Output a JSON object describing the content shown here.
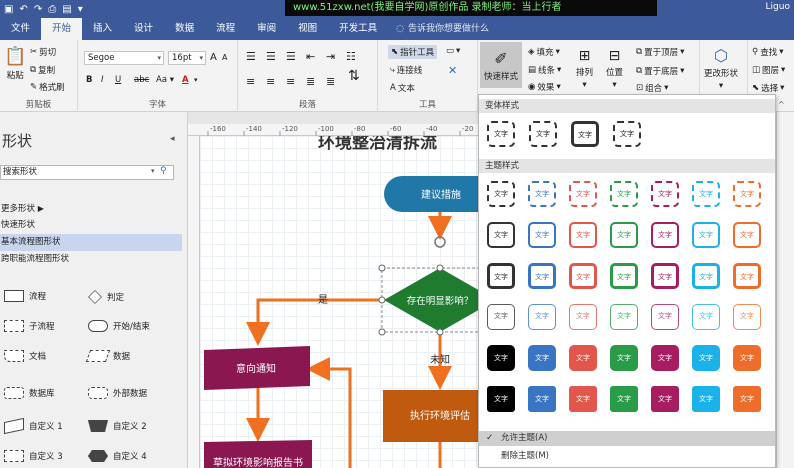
{
  "titlebar": {
    "banner": "www.51zxw.net(我要自学网)原创作品 录制老师：当上行者",
    "user": "Liguo"
  },
  "tabs": [
    {
      "label": "文件"
    },
    {
      "label": "开始"
    },
    {
      "label": "插入"
    },
    {
      "label": "设计"
    },
    {
      "label": "数据"
    },
    {
      "label": "流程"
    },
    {
      "label": "审阅"
    },
    {
      "label": "视图"
    },
    {
      "label": "开发工具"
    }
  ],
  "tellme": "告诉我你想要做什么",
  "ribbon": {
    "clipboard": {
      "label": "剪贴板",
      "paste": "粘贴",
      "cut": "剪切",
      "copy": "复制",
      "format_painter": "格式刷"
    },
    "font": {
      "label": "字体",
      "family": "Segoe",
      "size": "16pt"
    },
    "paragraph": {
      "label": "段落"
    },
    "tools": {
      "label": "工具",
      "pointer": "指针工具",
      "connector": "连接线",
      "text": "文本"
    },
    "shape_styles": {
      "quick": "快速样式",
      "fill": "填充",
      "line": "线条",
      "effects": "效果"
    },
    "arrange": {
      "arrange": "排列",
      "position": "位置",
      "front": "置于顶层",
      "back": "置于底层",
      "group": "组合"
    },
    "change_shape": "更改形状",
    "editing": {
      "find": "查找",
      "layer": "图层",
      "select": "选择"
    }
  },
  "shapes_pane": {
    "title": "形状",
    "search": "搜索形状",
    "stencils": [
      "更多形状",
      "快速形状",
      "基本流程图形状",
      "跨职能流程图形状"
    ],
    "shapes": [
      {
        "label": "流程",
        "icon": "process-icon"
      },
      {
        "label": "判定",
        "icon": "decision-icon"
      },
      {
        "label": "子流程",
        "icon": "subprocess-icon"
      },
      {
        "label": "开始/结束",
        "icon": "start-end-icon"
      },
      {
        "label": "文档",
        "icon": "document-icon"
      },
      {
        "label": "数据",
        "icon": "data-icon"
      },
      {
        "label": "数据库",
        "icon": "database-icon"
      },
      {
        "label": "外部数据",
        "icon": "external-data-icon"
      },
      {
        "label": "自定义 1",
        "icon": "custom1-icon"
      },
      {
        "label": "自定义 2",
        "icon": "custom2-icon"
      },
      {
        "label": "自定义 3",
        "icon": "custom3-icon"
      },
      {
        "label": "自定义 4",
        "icon": "custom4-icon"
      }
    ]
  },
  "ruler_labels": [
    "-160",
    "-140",
    "-120",
    "-100",
    "-80",
    "-60",
    "-40",
    "-20"
  ],
  "diagram": {
    "title": "环境整治清拆流",
    "nodes": {
      "n1": "建议措施",
      "n2": "存在明显影响？",
      "n3": "意向通知",
      "n4": "执行环境评估",
      "n5": "草拟环境影响报告书"
    },
    "labels": {
      "yes": "是",
      "no": "未知"
    },
    "colors": {
      "start": "#1f78a8",
      "decision": "#1f7b2e",
      "notice": "#8b1750",
      "process": "#c05a0f",
      "connector": "#f07020"
    }
  },
  "gallery": {
    "variant_title": "变体样式",
    "theme_title": "主题样式",
    "swatch_text": "文字",
    "variant_colors": [
      "#333333",
      "#333333",
      "#333333",
      "#333333"
    ],
    "palette": [
      "#333333",
      "#3a75c4",
      "#e2564b",
      "#2a9c48",
      "#a81c62",
      "#1ab2e8",
      "#ef6d2b"
    ],
    "rows": [
      "outline-dashed",
      "outline-solid",
      "outline-bold",
      "outline-light",
      "filled",
      "filled-rough"
    ],
    "allow_theme": "允许主题(A)",
    "remove_theme": "删除主题(M)"
  }
}
